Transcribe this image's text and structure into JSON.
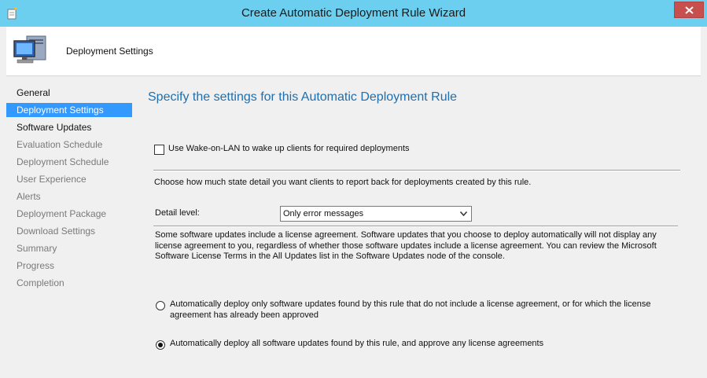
{
  "window": {
    "title": "Create Automatic Deployment Rule Wizard",
    "titlebar_color": "#6ccff0",
    "close_color": "#c7504e"
  },
  "header": {
    "title": "Deployment Settings"
  },
  "nav": {
    "items": [
      {
        "label": "General",
        "state": "done"
      },
      {
        "label": "Deployment Settings",
        "state": "active"
      },
      {
        "label": "Software Updates",
        "state": "done"
      },
      {
        "label": "Evaluation Schedule",
        "state": "pending"
      },
      {
        "label": "Deployment Schedule",
        "state": "pending"
      },
      {
        "label": "User Experience",
        "state": "pending"
      },
      {
        "label": "Alerts",
        "state": "pending"
      },
      {
        "label": "Deployment Package",
        "state": "pending"
      },
      {
        "label": "Download Settings",
        "state": "pending"
      },
      {
        "label": "Summary",
        "state": "pending"
      },
      {
        "label": "Progress",
        "state": "pending"
      },
      {
        "label": "Completion",
        "state": "pending"
      }
    ],
    "active_color": "#3399ff"
  },
  "content": {
    "heading": "Specify the settings for this Automatic Deployment Rule",
    "wake_on_lan": {
      "label": "Use Wake-on-LAN to wake up clients for required deployments",
      "checked": false
    },
    "state_detail_text": "Choose how much state detail you want clients to report back for deployments created by this rule.",
    "detail_level": {
      "label": "Detail level:",
      "value": "Only error messages"
    },
    "license_text": "Some software updates include a license agreement. Software updates that you choose to deploy automatically will not display any license agreement to you, regardless of whether those software updates include a license agreement. You can review the Microsoft Software License Terms in the All Updates list in the Software Updates node of the console.",
    "radio_options": [
      {
        "label": "Automatically deploy only software updates found by this rule that do not include a license agreement, or for which the license agreement has already been approved",
        "selected": false
      },
      {
        "label": "Automatically deploy all software updates found by this rule, and approve any license agreements",
        "selected": true
      }
    ],
    "heading_color": "#1e6fb0"
  }
}
